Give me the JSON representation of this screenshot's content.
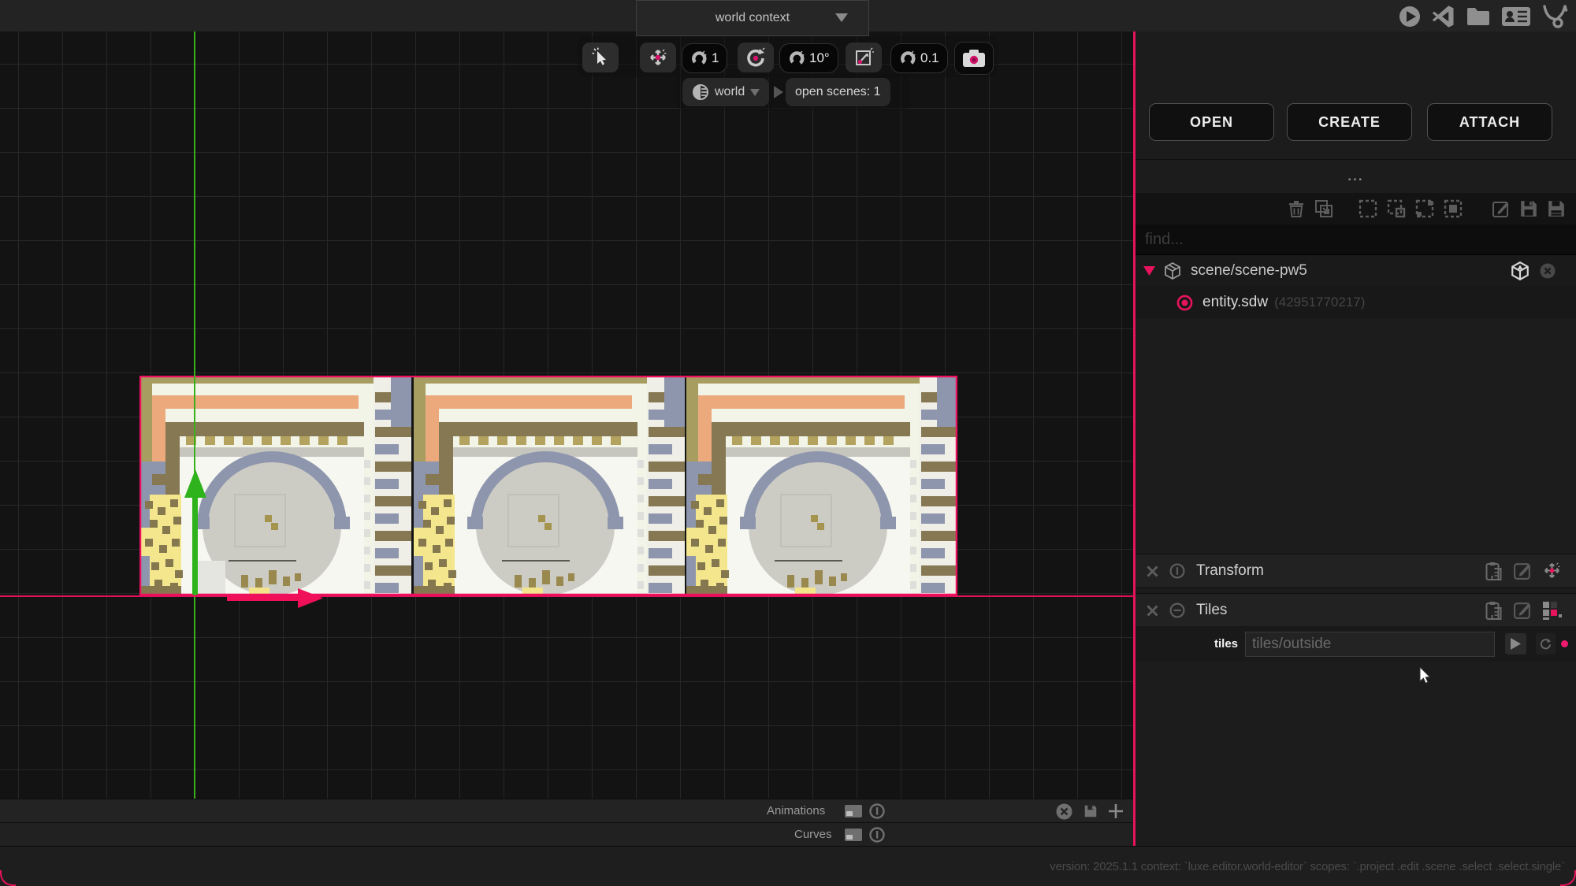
{
  "window": {
    "context_selector": "world context"
  },
  "header_icons": [
    "play-icon",
    "vscode-icon",
    "folder-icon",
    "contact-card-icon",
    "luxe-logo-icon"
  ],
  "toolbar": {
    "snap_position_value": "1",
    "snap_rotation_value": "10°",
    "snap_scale_value": "0.1"
  },
  "scene_bar": {
    "world": "world",
    "open_scenes": "open scenes: 1"
  },
  "right_panel": {
    "open": "OPEN",
    "create": "CREATE",
    "attach": "ATTACH",
    "overflow": "...",
    "find_placeholder": "find...",
    "scene_node": "scene/scene-pw5",
    "entity_node": "entity.sdw",
    "entity_id": "(42951770217)",
    "transform_title": "Transform",
    "tiles_title": "Tiles",
    "tiles_label": "tiles",
    "tiles_value": "tiles/outside"
  },
  "timeline": {
    "animations": "Animations",
    "curves": "Curves"
  },
  "status": {
    "text": "version: 2025.1.1 context: `luxe.editor.world-editor` scopes: `.project .edit .scene .select .select.single`"
  },
  "colors": {
    "accent_pink": "#e7135c",
    "axis_y_green": "#38b11d",
    "axis_x_pink": "#e20f59",
    "selection_border": "#ee105e"
  }
}
